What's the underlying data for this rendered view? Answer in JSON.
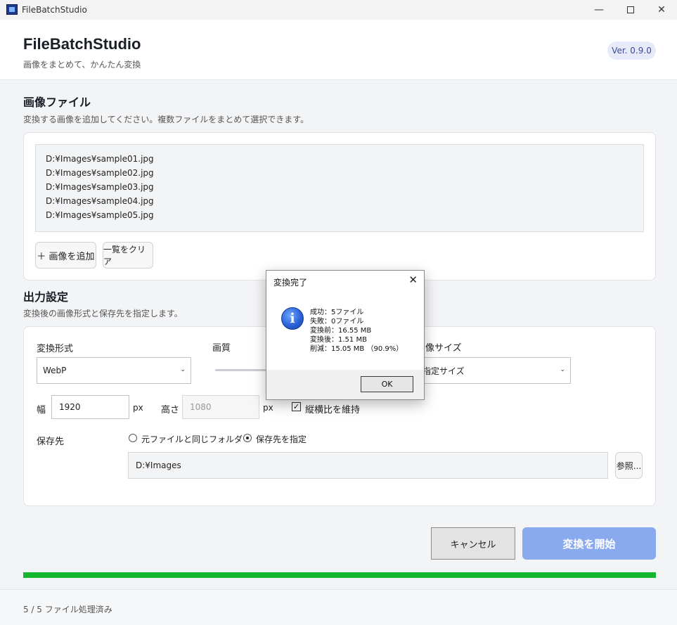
{
  "window": {
    "title": "FileBatchStudio",
    "min_icon": "minimize-icon",
    "max_icon": "maximize-icon",
    "close_icon": "close-icon"
  },
  "header": {
    "app_name": "FileBatchStudio",
    "subtitle": "画像をまとめて、かんたん変換",
    "version": "Ver. 0.9.0"
  },
  "images_section": {
    "title": "画像ファイル",
    "description": "変換する画像を追加してください。複数ファイルをまとめて選択できます。",
    "files": [
      "D:¥Images¥sample01.jpg",
      "D:¥Images¥sample02.jpg",
      "D:¥Images¥sample03.jpg",
      "D:¥Images¥sample04.jpg",
      "D:¥Images¥sample05.jpg"
    ],
    "add_button": "＋ 画像を追加",
    "clear_button": "一覧をクリア"
  },
  "output_section": {
    "title": "出力設定",
    "description": "変換後の画像形式と保存先を指定します。",
    "format_label": "変換形式",
    "format_value": "WebP",
    "quality_label": "画質",
    "size_label": "画像サイズ",
    "size_value": "指定サイズ",
    "width_label": "幅",
    "width_value": "1920",
    "width_unit": "px",
    "height_label": "高さ",
    "height_placeholder": "1080",
    "height_unit": "px",
    "keep_ratio_label": "縦横比を維持",
    "keep_ratio_checked": true,
    "dest_label": "保存先",
    "radio_same_folder": "元ファイルと同じフォルダー",
    "radio_custom": "保存先を指定",
    "selected_radio": "custom",
    "dest_path": "D:¥Images",
    "browse_button": "参照..."
  },
  "actions": {
    "cancel": "キャンセル",
    "start": "変換を開始"
  },
  "progress": {
    "fraction": 1.0,
    "color": "#14b62f",
    "status": "5 / 5 ファイル処理済み"
  },
  "dialog": {
    "title": "変換完了",
    "icon": "info-icon",
    "lines": [
      "成功：5ファイル",
      "失敗：0ファイル",
      "変換前：16.55 MB",
      "変換後：1.51 MB",
      "削減：15.05 MB （90.9%）"
    ],
    "ok": "OK"
  },
  "colors": {
    "accent": "#8aaaf0",
    "progress": "#14b62f"
  }
}
